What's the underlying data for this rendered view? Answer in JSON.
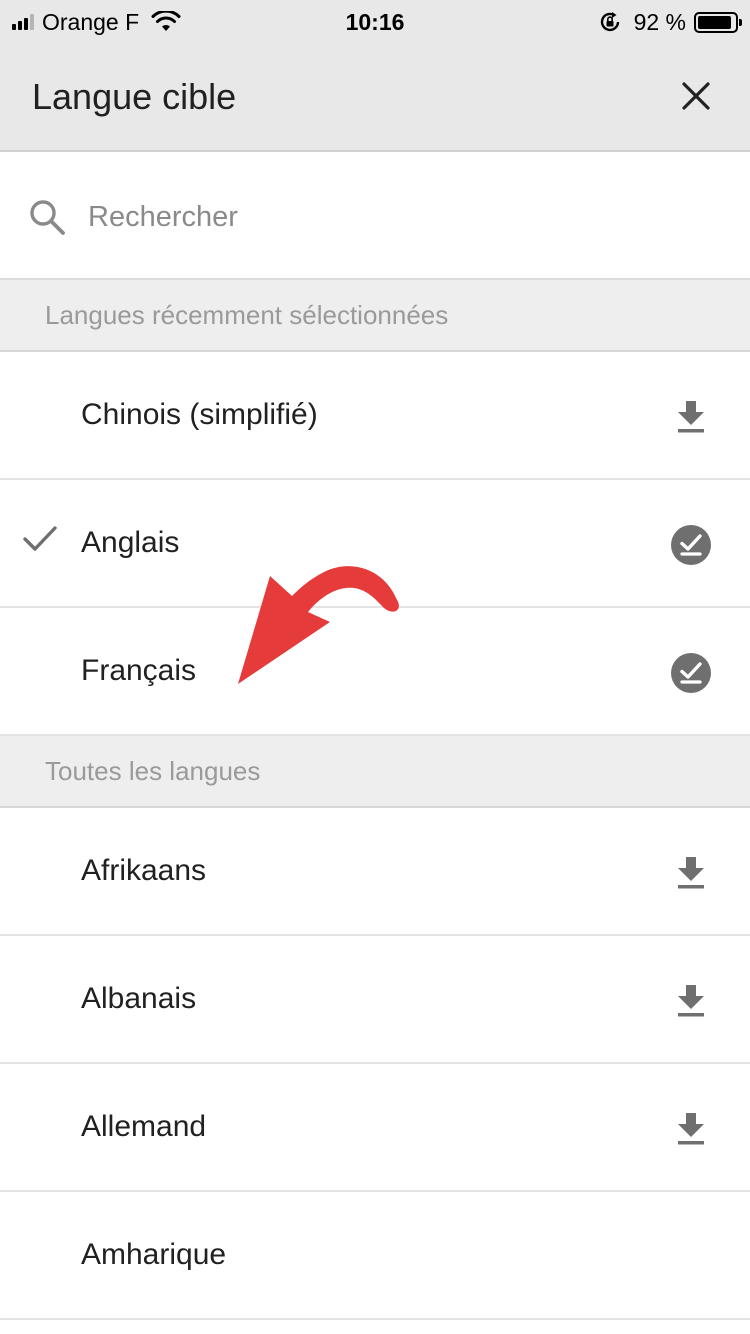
{
  "status_bar": {
    "carrier": "Orange F",
    "time": "10:16",
    "battery_percent": "92 %",
    "battery_level": 0.92
  },
  "header": {
    "title": "Langue cible",
    "close_icon": "close-icon"
  },
  "search": {
    "placeholder": "Rechercher",
    "value": ""
  },
  "sections": {
    "recent_title": "Langues récemment sélectionnées",
    "all_title": "Toutes les langues"
  },
  "recent_languages": [
    {
      "label": "Chinois (simplifié)",
      "selected": false,
      "status_icon": "download-icon"
    },
    {
      "label": "Anglais",
      "selected": true,
      "status_icon": "downloaded-check-icon"
    },
    {
      "label": "Français",
      "selected": false,
      "status_icon": "downloaded-check-icon"
    }
  ],
  "all_languages": [
    {
      "label": "Afrikaans",
      "status_icon": "download-icon"
    },
    {
      "label": "Albanais",
      "status_icon": "download-icon"
    },
    {
      "label": "Allemand",
      "status_icon": "download-icon"
    },
    {
      "label": "Amharique",
      "status_icon": ""
    }
  ],
  "colors": {
    "header_bg": "#e8e8e8",
    "section_bg": "#eeeeee",
    "section_text": "#9a9a9a",
    "icon_gray": "#6f6f6f",
    "annotation_red": "#e63b3b"
  }
}
